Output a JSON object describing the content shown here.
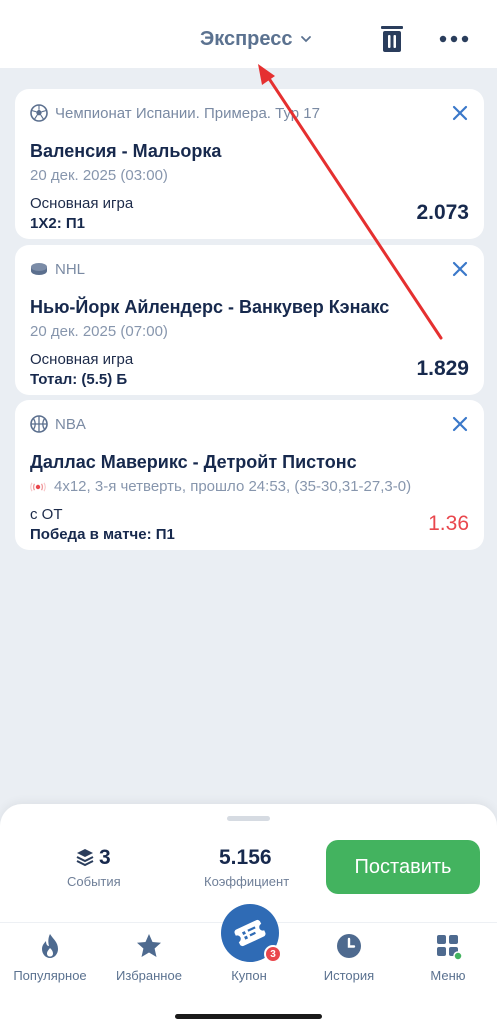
{
  "header": {
    "title": "Экспресс",
    "icons": [
      "chevron-down-icon",
      "trash-icon",
      "more-icon"
    ]
  },
  "bets": [
    {
      "sport_icon": "soccer-ball-icon",
      "league": "Чемпионат Испании. Примера. Тур 17",
      "match": "Валенсия - Мальорка",
      "date": "20 дек. 2025 (03:00)",
      "market": "Основная игра",
      "pick": "1X2: П1",
      "odds": "2.073"
    },
    {
      "sport_icon": "hockey-puck-icon",
      "league": "NHL",
      "match": "Нью-Йорк Айлендерс - Ванкувер Кэнакс",
      "date": "20 дек. 2025 (07:00)",
      "market": "Основная игра",
      "pick": "Тотал: (5.5) Б",
      "odds": "1.829"
    },
    {
      "sport_icon": "basketball-icon",
      "league": "NBA",
      "match": "Даллас Маверикс - Детройт Пистонс",
      "live_status": "4х12, 3-я четверть, прошло 24:53, (35-30,31-27,3-0)",
      "market": "с ОТ",
      "pick": "Победа в матче: П1",
      "odds": "1.36",
      "odds_color": "#e9474d"
    }
  ],
  "summary": {
    "events_count": "3",
    "events_label": "События",
    "coefficient": "5.156",
    "coefficient_label": "Коэффициент",
    "place_button": "Поставить"
  },
  "nav": {
    "items": [
      {
        "label": "Популярное",
        "icon": "flame-icon"
      },
      {
        "label": "Избранное",
        "icon": "star-icon"
      },
      {
        "label": "Купон",
        "icon": "ticket-icon",
        "badge": "3"
      },
      {
        "label": "История",
        "icon": "clock-icon"
      },
      {
        "label": "Меню",
        "icon": "grid-icon"
      }
    ]
  },
  "colors": {
    "accent_blue": "#2f6bb5",
    "place_green": "#43b35f",
    "live_red": "#e9474d",
    "annotation_arrow": "#e53030"
  }
}
